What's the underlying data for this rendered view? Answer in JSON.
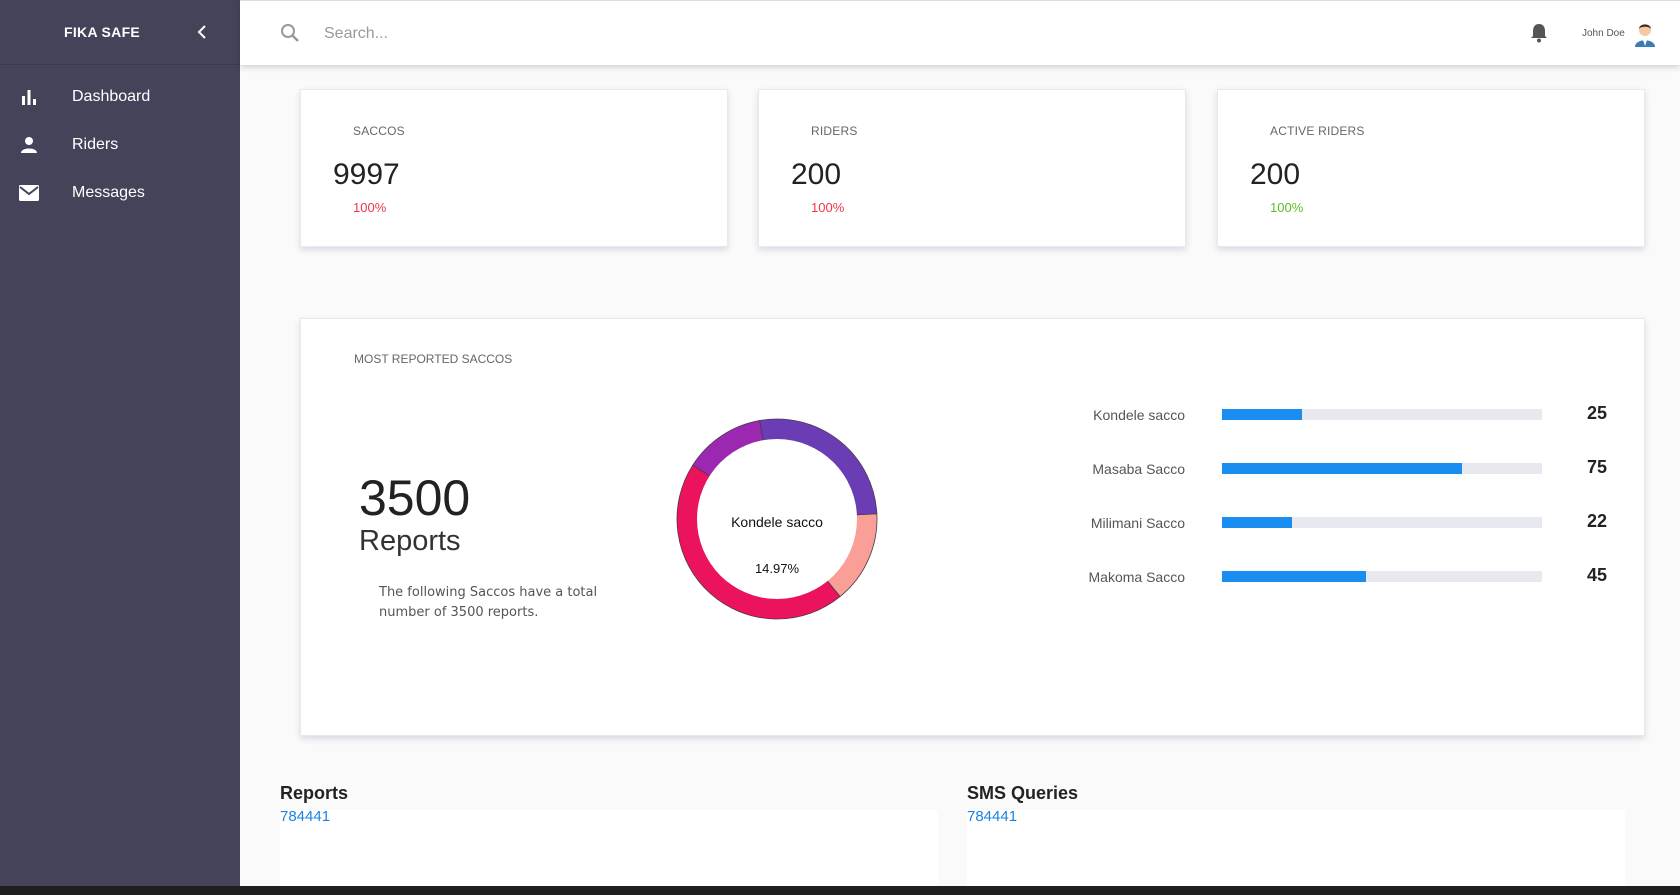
{
  "sidebar": {
    "brand": "FIKA SAFE",
    "items": [
      {
        "label": "Dashboard",
        "icon": "bar-chart-icon"
      },
      {
        "label": "Riders",
        "icon": "person-icon"
      },
      {
        "label": "Messages",
        "icon": "mail-icon"
      }
    ]
  },
  "topbar": {
    "search_placeholder": "Search...",
    "user_name": "John Doe"
  },
  "stats": [
    {
      "title": "SACCOS",
      "value": "9997",
      "percent": "100%",
      "percent_color": "#f0364a"
    },
    {
      "title": "RIDERS",
      "value": "200",
      "percent": "100%",
      "percent_color": "#f0364a"
    },
    {
      "title": "ACTIVE RIDERS",
      "value": "200",
      "percent": "100%",
      "percent_color": "#5bbf2a"
    }
  ],
  "most_reported": {
    "title": "MOST REPORTED SACCOS",
    "total": "3500",
    "total_label": "Reports",
    "description": "The following Saccos have a total number of 3500 reports.",
    "donut_center_label": "Kondele sacco",
    "donut_center_value": "14.97%",
    "bars": [
      {
        "label": "Kondele sacco",
        "value": "25",
        "fraction": 0.25
      },
      {
        "label": "Masaba Sacco",
        "value": "75",
        "fraction": 0.75
      },
      {
        "label": "Milimani Sacco",
        "value": "22",
        "fraction": 0.22
      },
      {
        "label": "Makoma Sacco",
        "value": "45",
        "fraction": 0.45
      }
    ]
  },
  "chart_data": {
    "type": "pie",
    "categories": [
      "Kondele sacco",
      "Masaba Sacco",
      "Milimani Sacco",
      "Makoma Sacco"
    ],
    "values": [
      25,
      75,
      22,
      45
    ],
    "colors": [
      "#f99f97",
      "#ec135e",
      "#9c27b0",
      "#6a3db5"
    ]
  },
  "panels": [
    {
      "title": "Reports",
      "link": "784441"
    },
    {
      "title": "SMS Queries",
      "link": "784441"
    }
  ]
}
